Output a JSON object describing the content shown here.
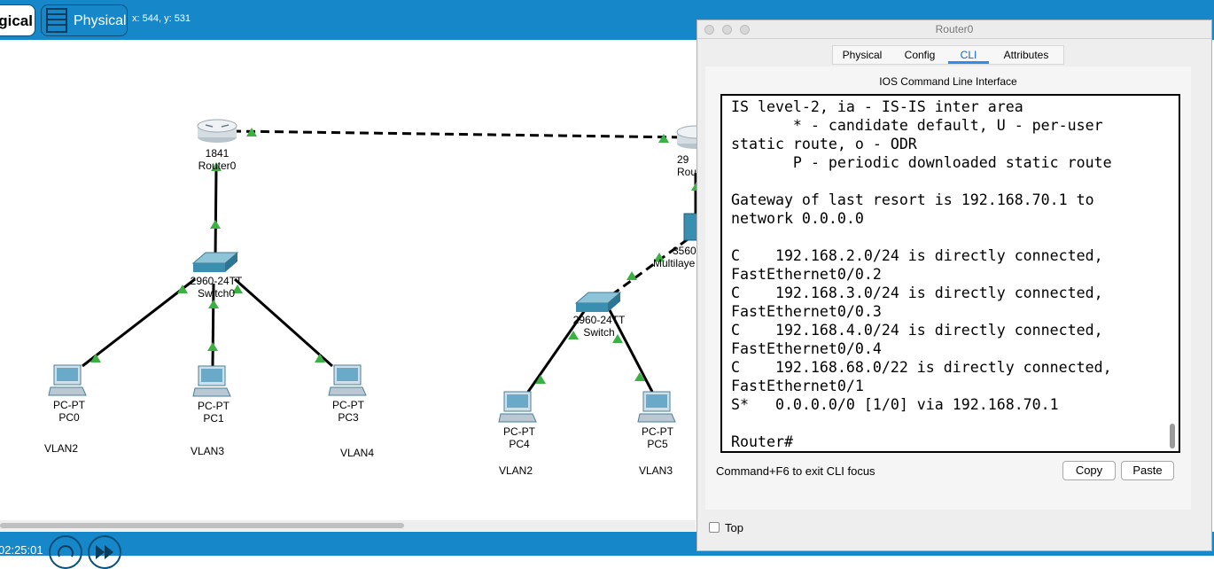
{
  "toolbar": {
    "logical_label": "gical",
    "physical_label": "Physical",
    "coordinates": "x: 544, y: 531"
  },
  "status": {
    "time": "02:25:01"
  },
  "topology": {
    "devices": [
      {
        "model": "1841",
        "name": "Router0"
      },
      {
        "model": "29",
        "name": "Rou"
      },
      {
        "model": "2960-24TT",
        "name": "Switch0"
      },
      {
        "model": "3560",
        "name": "Multilaye"
      },
      {
        "model": "2960-24TT",
        "name": "Switch"
      },
      {
        "model": "PC-PT",
        "name": "PC0"
      },
      {
        "model": "PC-PT",
        "name": "PC1"
      },
      {
        "model": "PC-PT",
        "name": "PC3"
      },
      {
        "model": "PC-PT",
        "name": "PC4"
      },
      {
        "model": "PC-PT",
        "name": "PC5"
      }
    ],
    "vlans": [
      "VLAN2",
      "VLAN3",
      "VLAN4",
      "VLAN2",
      "VLAN3"
    ]
  },
  "window": {
    "title": "Router0",
    "tabs": [
      "Physical",
      "Config",
      "CLI",
      "Attributes"
    ],
    "active_tab": "CLI",
    "cli_title": "IOS Command Line Interface",
    "cli_lines": [
      "IS level-2, ia - IS-IS inter area",
      "       * - candidate default, U - per-user",
      "static route, o - ODR",
      "       P - periodic downloaded static route",
      "",
      "Gateway of last resort is 192.168.70.1 to",
      "network 0.0.0.0",
      "",
      "C    192.168.2.0/24 is directly connected,",
      "FastEthernet0/0.2",
      "C    192.168.3.0/24 is directly connected,",
      "FastEthernet0/0.3",
      "C    192.168.4.0/24 is directly connected,",
      "FastEthernet0/0.4",
      "C    192.168.68.0/22 is directly connected,",
      "FastEthernet0/1",
      "S*   0.0.0.0/0 [1/0] via 192.168.70.1",
      "",
      "Router#"
    ],
    "hint": "Command+F6 to exit CLI focus",
    "copy_label": "Copy",
    "paste_label": "Paste",
    "top_label": "Top"
  },
  "colors": {
    "accent": "#1687c8",
    "link_up": "#3cb043",
    "device": "#3a8fb0"
  }
}
